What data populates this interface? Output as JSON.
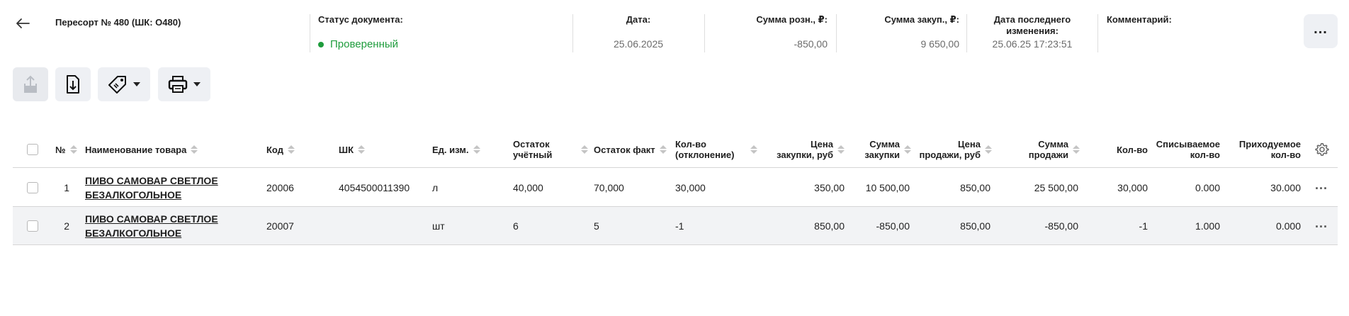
{
  "header": {
    "title": "Пересорт № 480 (ШК: O480)",
    "status_label": "Статус документа:",
    "status_value": "Проверенный",
    "date_label": "Дата:",
    "date_value": "25.06.2025",
    "retail_label": "Сумма розн., ₽:",
    "retail_value": "-850,00",
    "purchase_label": "Сумма закуп., ₽:",
    "purchase_value": "9 650,00",
    "modified_label_1": "Дата последнего",
    "modified_label_2": "изменения:",
    "modified_value": "25.06.25 17:23:51",
    "comment_label": "Комментарий:",
    "more_glyph": "..."
  },
  "colors": {
    "status": "#1e9c3c",
    "toolbar_bg": "#eef0f4",
    "row_alt": "#f2f3f5"
  },
  "toolbar": {
    "icons": [
      "share-icon",
      "download-icon",
      "tag-icon",
      "printer-icon"
    ]
  },
  "table": {
    "headers": {
      "num": "№",
      "name": "Наименование товара",
      "code": "Код",
      "barcode": "ШК",
      "unit": "Ед. изм.",
      "stock_acc_1": "Остаток",
      "stock_acc_2": "учётный",
      "stock_fact": "Остаток факт",
      "qty_dev_1": "Кол-во",
      "qty_dev_2": "(отклонение)",
      "price_buy_1": "Цена",
      "price_buy_2": "закупки, руб",
      "sum_buy_1": "Сумма",
      "sum_buy_2": "закупки",
      "price_sell_1": "Цена",
      "price_sell_2": "продажи, руб",
      "sum_sell_1": "Сумма",
      "sum_sell_2": "продажи",
      "qty": "Кол-во",
      "writeoff_1": "Списываемое",
      "writeoff_2": "кол-во",
      "incoming_1": "Приходуемое",
      "incoming_2": "кол-во"
    },
    "rows": [
      {
        "num": "1",
        "name_1": "ПИВО САМОВАР СВЕТЛОЕ",
        "name_2": "БЕЗАЛКОГОЛЬНОЕ",
        "code": "20006",
        "barcode": "4054500011390",
        "unit": "л",
        "stock_acc": "40,000",
        "stock_fact": "70,000",
        "qty_dev": "30,000",
        "price_buy": "350,00",
        "sum_buy": "10 500,00",
        "price_sell": "850,00",
        "sum_sell": "25 500,00",
        "qty": "30,000",
        "writeoff": "0.000",
        "incoming": "30.000",
        "menu": "..."
      },
      {
        "num": "2",
        "name_1": "ПИВО САМОВАР СВЕТЛОЕ",
        "name_2": "БЕЗАЛКОГОЛЬНОЕ",
        "code": "20007",
        "barcode": "",
        "unit": "шт",
        "stock_acc": "6",
        "stock_fact": "5",
        "qty_dev": "-1",
        "price_buy": "850,00",
        "sum_buy": "-850,00",
        "price_sell": "850,00",
        "sum_sell": "-850,00",
        "qty": "-1",
        "writeoff": "1.000",
        "incoming": "0.000",
        "menu": "..."
      }
    ]
  }
}
